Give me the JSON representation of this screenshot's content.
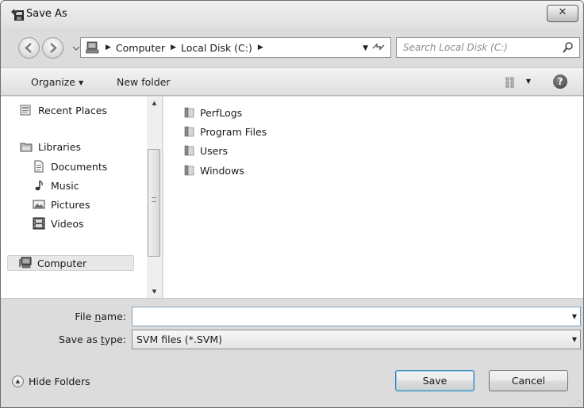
{
  "window": {
    "title": "Save As",
    "close_glyph": "✕",
    "icon": "save-as-app-icon"
  },
  "nav": {
    "back_icon": "back-arrow-icon",
    "forward_icon": "forward-arrow-icon",
    "address": {
      "crumbs": [
        "Computer",
        "Local Disk (C:)"
      ],
      "refresh_glyph": "↻"
    },
    "search": {
      "placeholder": "Search Local Disk (C:)"
    }
  },
  "toolbar": {
    "organize_label": "Organize",
    "new_folder_label": "New folder",
    "help_glyph": "?"
  },
  "sidebar": {
    "items": [
      {
        "label": "Recent Places",
        "icon": "recent-places-icon"
      },
      {
        "label": "Libraries",
        "icon": "libraries-icon"
      },
      {
        "label": "Documents",
        "icon": "documents-icon"
      },
      {
        "label": "Music",
        "icon": "music-icon"
      },
      {
        "label": "Pictures",
        "icon": "pictures-icon"
      },
      {
        "label": "Videos",
        "icon": "videos-icon"
      },
      {
        "label": "Computer",
        "icon": "computer-icon",
        "selected": true
      }
    ]
  },
  "files": [
    {
      "name": "PerfLogs",
      "icon": "folder-icon"
    },
    {
      "name": "Program Files",
      "icon": "folder-icon"
    },
    {
      "name": "Users",
      "icon": "folder-icon"
    },
    {
      "name": "Windows",
      "icon": "folder-icon"
    }
  ],
  "form": {
    "file_name_label_pre": "File ",
    "file_name_label_access": "n",
    "file_name_label_post": "ame:",
    "file_name_value": "",
    "save_type_label_pre": "Save as ",
    "save_type_label_access": "t",
    "save_type_label_post": "ype:",
    "save_type_value": "SVM files (*.SVM)"
  },
  "footer": {
    "hide_folders_label": "Hide Folders",
    "save_label": "Save",
    "cancel_label": "Cancel"
  }
}
